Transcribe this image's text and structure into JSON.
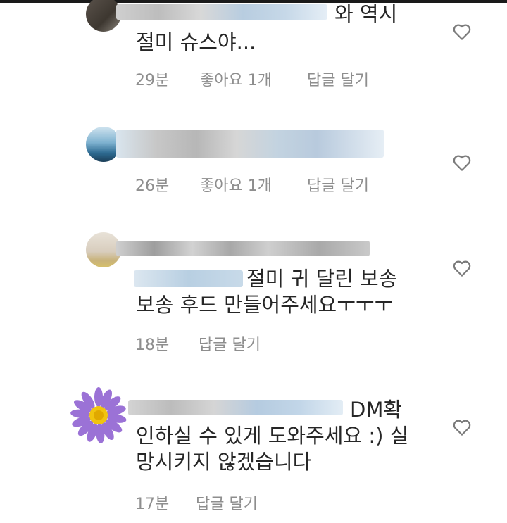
{
  "comments": [
    {
      "text_lines": [
        "와 역시",
        "절미 슈스야..."
      ],
      "time": "29분",
      "likes": "좋아요 1개",
      "reply": "답글 달기",
      "like_icon": "heart-outline-icon"
    },
    {
      "text_lines": [],
      "time": "26분",
      "likes": "좋아요 1개",
      "reply": "답글 달기",
      "like_icon": "heart-outline-icon"
    },
    {
      "text_lines": [
        "절미 귀 달린 보송",
        "보송 후드 만들어주세요ㅜㅜㅜ"
      ],
      "time": "18분",
      "reply": "답글 달기",
      "like_icon": "heart-outline-icon"
    },
    {
      "text_lines": [
        "DM확",
        "인하실 수 있게 도와주세요 :) 실",
        "망시키지 않겠습니다"
      ],
      "time": "17분",
      "reply": "답글 달기",
      "like_icon": "heart-outline-icon"
    }
  ]
}
